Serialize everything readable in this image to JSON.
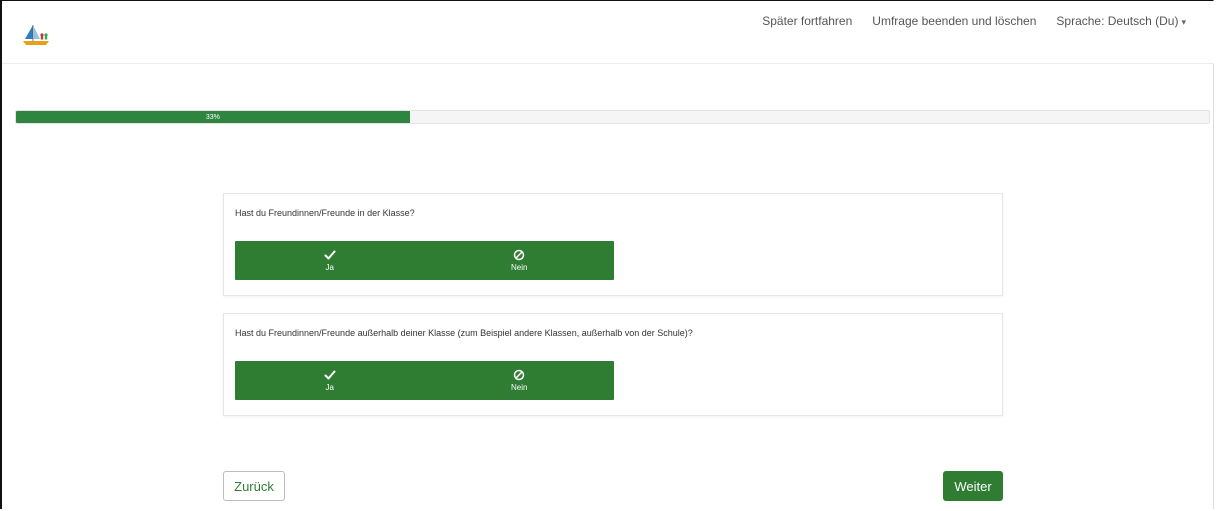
{
  "nav": {
    "later": "Später fortfahren",
    "finish_delete": "Umfrage beenden und löschen",
    "language": "Sprache: Deutsch (Du)",
    "language_caret": "▾"
  },
  "progress": {
    "value_percent": 33,
    "label": "33%"
  },
  "questions": [
    {
      "text": "Hast du Freundinnen/Freunde in der Klasse?",
      "yes_label": "Ja",
      "no_label": "Nein"
    },
    {
      "text": "Hast du Freundinnen/Freunde außerhalb deiner Klasse (zum Beispiel andere Klassen, außerhalb von der Schule)?",
      "yes_label": "Ja",
      "no_label": "Nein"
    }
  ],
  "footer": {
    "back_label": "Zurück",
    "next_label": "Weiter"
  },
  "colors": {
    "accent": "#2e7d32",
    "progress": "#2e8540"
  },
  "icons": {
    "yes": "check-icon",
    "no": "ban-icon",
    "logo": "sailboat-logo-icon"
  }
}
